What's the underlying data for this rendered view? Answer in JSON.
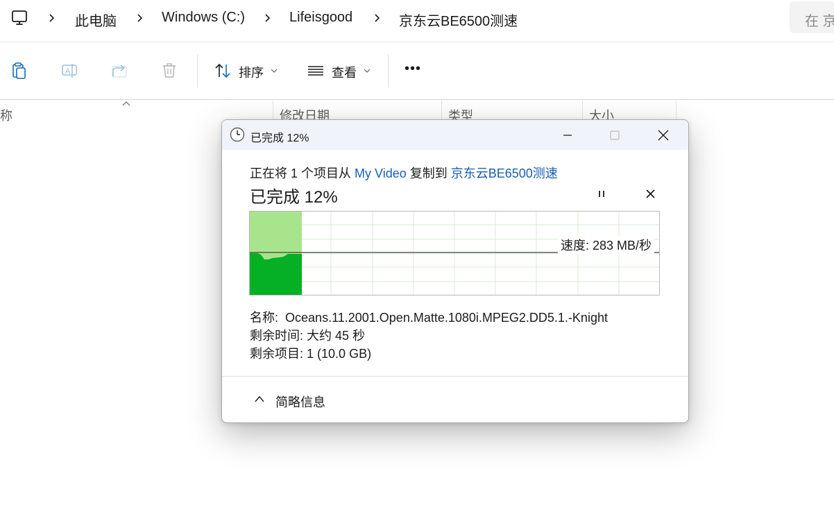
{
  "address_bar": {
    "pc_icon": "computer-icon",
    "breadcrumbs": [
      "此电脑",
      "Windows (C:)",
      "Lifeisgood",
      "京东云BE6500测速"
    ],
    "search_placeholder": "在 京"
  },
  "command_bar": {
    "icons": [
      "clipboard-icon",
      "rename-icon",
      "share-icon",
      "delete-icon"
    ],
    "sort_label": "排序",
    "view_label": "查看",
    "more_label": "•••"
  },
  "columns": {
    "name": "称",
    "modified": "修改日期",
    "type": "类型",
    "size": "大小"
  },
  "dialog": {
    "title": "已完成 12%",
    "copy_prefix": "正在将 1 个项目从 ",
    "source": "My Video",
    "copy_mid": " 复制到 ",
    "destination": "京东云BE6500测速",
    "progress_text": "已完成 12%",
    "progress_percent": 12,
    "speed_text": "速度: 283 MB/秒",
    "name_label": "名称:",
    "name_value": "Oceans.11.2001.Open.Matte.1080i.MPEG2.DD5.1.-Knight",
    "time_label": "剩余时间:",
    "time_value": "大约 45 秒",
    "items_label": "剩余项目:",
    "items_value": "1 (10.0 GB)",
    "details_toggle": "简略信息",
    "colors": {
      "progress_light": "#a8e48c",
      "progress_dark": "#06b025",
      "grid": "#d3ecd3",
      "link": "#1a5fb4"
    }
  }
}
